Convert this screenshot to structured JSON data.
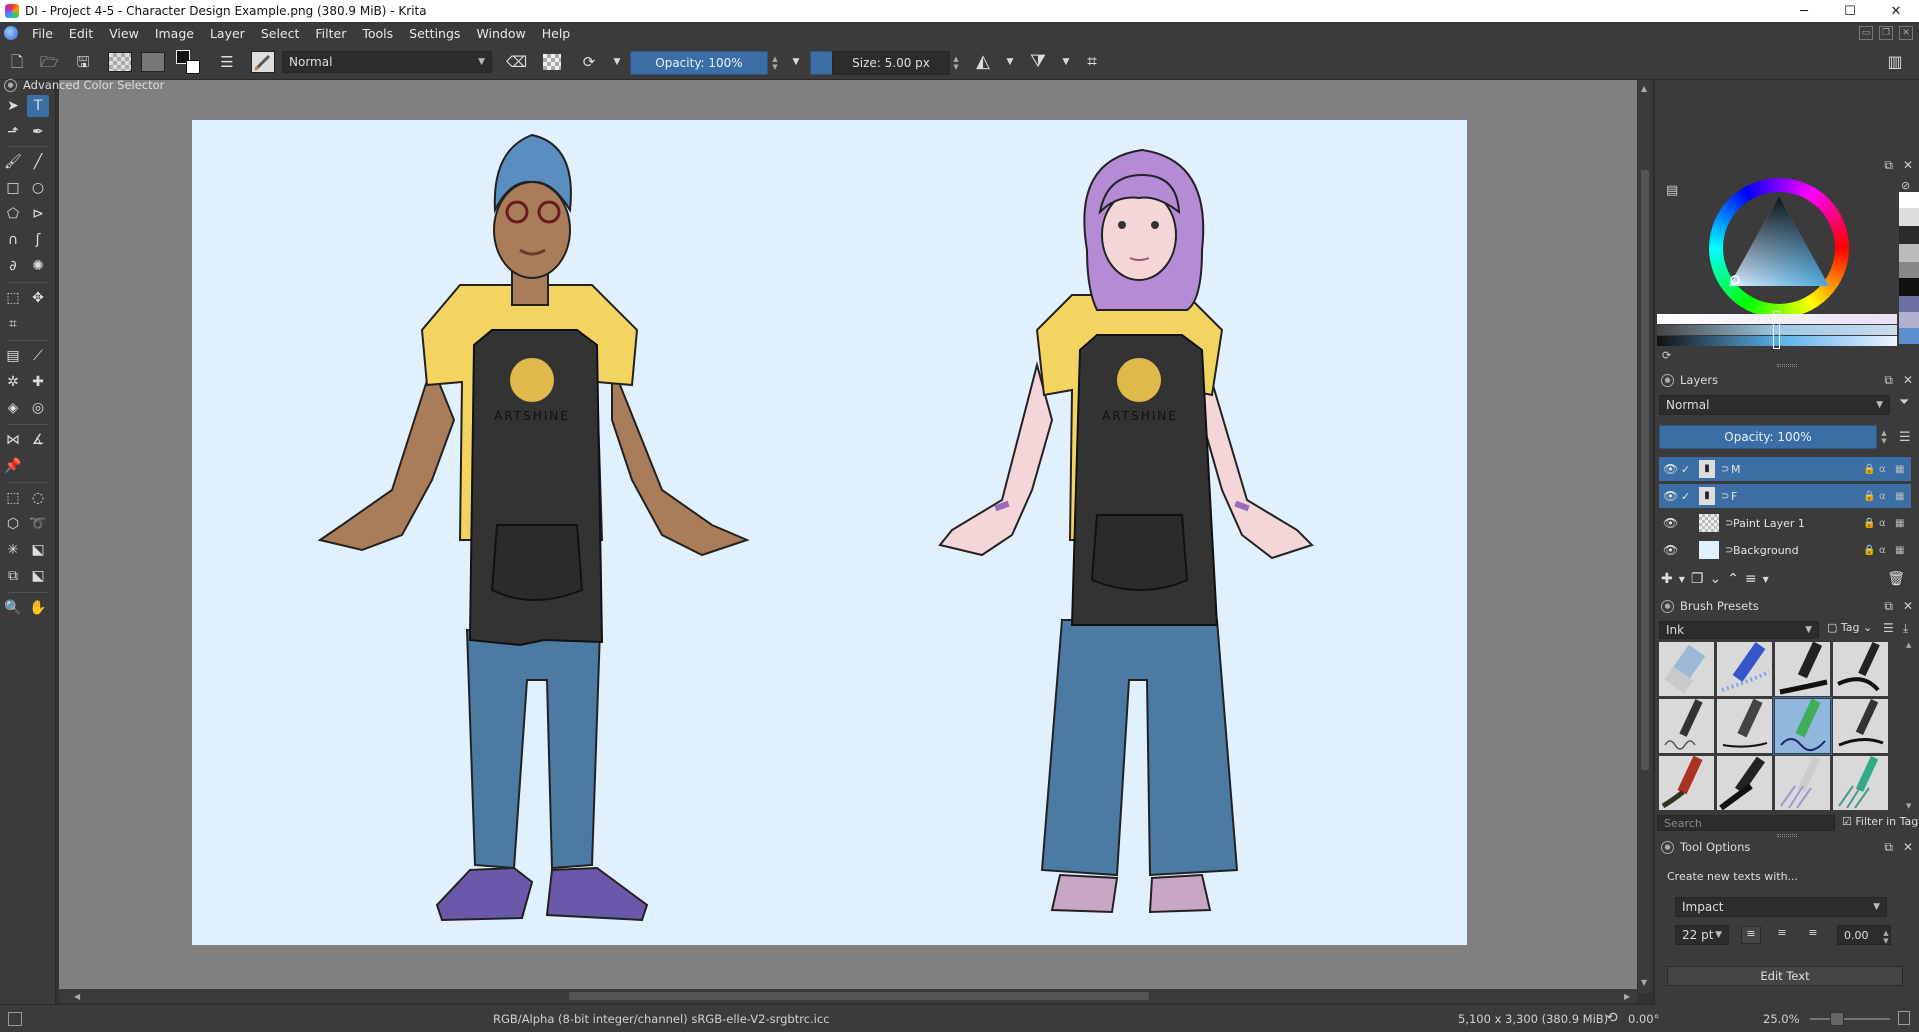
{
  "window": {
    "title": "DI - Project 4-5 - Character Design Example.png (380.9 MiB)  - Krita",
    "controls": {
      "minimize": "─",
      "maximize": "☐",
      "close": "✕"
    }
  },
  "menu": [
    "File",
    "Edit",
    "View",
    "Image",
    "Layer",
    "Select",
    "Filter",
    "Tools",
    "Settings",
    "Window",
    "Help"
  ],
  "toolbar": {
    "blend_mode": "Normal",
    "opacity": "Opacity: 100%",
    "size": "Size: 5.00 px"
  },
  "canvas": {
    "apron_logo_text": "ARTSHINE"
  },
  "status": {
    "color_profile": "RGB/Alpha (8-bit integer/channel)  sRGB-elle-V2-srgbtrc.icc",
    "dimensions": "5,100 x 3,300 (380.9 MiB)",
    "rotation": "0.00°",
    "zoom": "25.0%"
  },
  "dockers": {
    "color_selector": {
      "title": "Advanced Color Selector"
    },
    "layers": {
      "title": "Layers",
      "blend_mode": "Normal",
      "opacity": "Opacity:  100%",
      "items": [
        {
          "name": "M",
          "selected": true,
          "checked": true
        },
        {
          "name": "F",
          "selected": true,
          "checked": true
        },
        {
          "name": "Paint Layer 1",
          "selected": false,
          "checked": false
        },
        {
          "name": "Background",
          "selected": false,
          "checked": false
        }
      ]
    },
    "brush_presets": {
      "title": "Brush Presets",
      "tag": "Ink",
      "tag_button": "Tag",
      "search_placeholder": "Search",
      "filter_in_tag": "Filter in Tag"
    },
    "tool_options": {
      "title": "Tool Options",
      "create_label": "Create new texts with...",
      "font": "Impact",
      "font_size": "22 pt",
      "spacing": "0.00",
      "edit_button": "Edit Text"
    }
  },
  "colors": {
    "accent": "#3a6ea5",
    "canvas_bg": "#e0f0fd",
    "panel": "#3b3b3b"
  }
}
